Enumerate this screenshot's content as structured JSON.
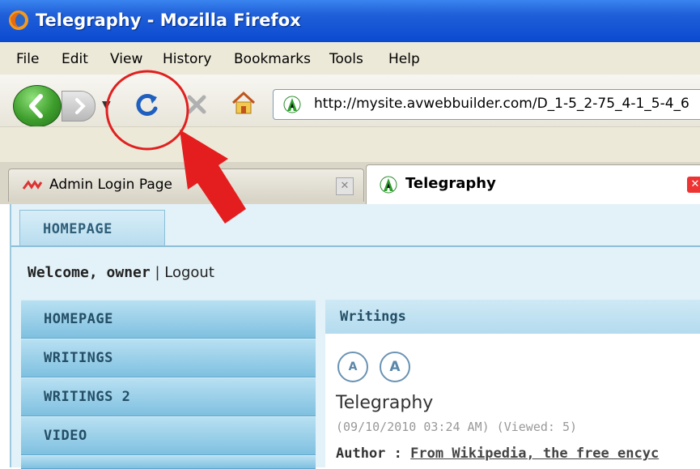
{
  "window": {
    "title": "Telegraphy - Mozilla Firefox"
  },
  "menu": [
    "File",
    "Edit",
    "View",
    "History",
    "Bookmarks",
    "Tools",
    "Help"
  ],
  "address_bar": {
    "url": "http://mysite.avwebbuilder.com/D_1-5_2-75_4-1_5-4_6"
  },
  "tabs": [
    {
      "label": "Admin Login Page",
      "active": false
    },
    {
      "label": "Telegraphy",
      "active": true
    }
  ],
  "site": {
    "top_tab": "HOMEPAGE",
    "welcome_label": "Welcome, owner",
    "separator": "|",
    "logout_label": "Logout",
    "sidebar": [
      "HOMEPAGE",
      "WRITINGS",
      "WRITINGS 2",
      "VIDEO"
    ],
    "content": {
      "header": "Writings",
      "font_buttons": [
        "A",
        "A"
      ],
      "article_title": "Telegraphy",
      "meta": "(09/10/2010 03:24 AM) (Viewed: 5)",
      "author_label": "Author :",
      "author_value": "From Wikipedia, the free encyc"
    }
  },
  "annotation": {
    "color": "#e02020",
    "target": "reload-button"
  },
  "colors": {
    "titlebar": "#1f5fd8",
    "accent_blue": "#7fc0e0",
    "chrome": "#ece9d8"
  }
}
